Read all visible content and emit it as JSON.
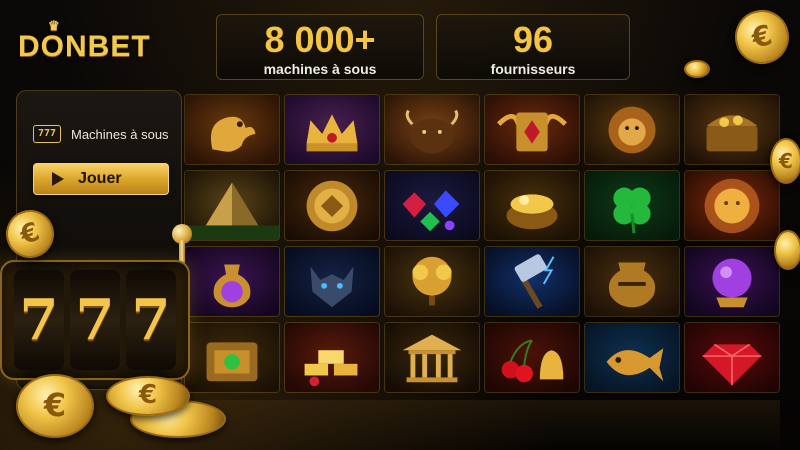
{
  "brand": {
    "logo_text": "DONBET"
  },
  "stats": [
    {
      "value": "8 000+",
      "label": "machines à sous"
    },
    {
      "value": "96",
      "label": "fournisseurs"
    }
  ],
  "panel": {
    "icon_text": "777",
    "title": "Machines à sous",
    "play_label": "Jouer"
  },
  "machine": {
    "reels": [
      "7",
      "7",
      "7"
    ]
  },
  "coin_symbol": "€",
  "colors": {
    "accent": "#f5c542",
    "background": "#060504"
  },
  "games": [
    {
      "name": "golden-dragon-tile"
    },
    {
      "name": "royal-crown-tile"
    },
    {
      "name": "buffalo-tile"
    },
    {
      "name": "golden-book-tile"
    },
    {
      "name": "golden-lion-tile"
    },
    {
      "name": "treasure-chest-tile"
    },
    {
      "name": "pyramid-tile"
    },
    {
      "name": "golden-medallion-tile"
    },
    {
      "name": "gems-tile"
    },
    {
      "name": "pot-of-gold-tile"
    },
    {
      "name": "four-leaf-clover-tile"
    },
    {
      "name": "golden-sun-tile"
    },
    {
      "name": "magic-potion-tile"
    },
    {
      "name": "wolf-tile"
    },
    {
      "name": "golden-tree-tile"
    },
    {
      "name": "thunder-hammer-tile"
    },
    {
      "name": "ancient-vase-tile"
    },
    {
      "name": "crystal-ball-tile"
    },
    {
      "name": "emerald-chest-tile"
    },
    {
      "name": "gold-ingots-tile"
    },
    {
      "name": "golden-temple-tile"
    },
    {
      "name": "cherries-bell-tile"
    },
    {
      "name": "golden-fish-tile"
    },
    {
      "name": "red-diamond-tile"
    }
  ]
}
